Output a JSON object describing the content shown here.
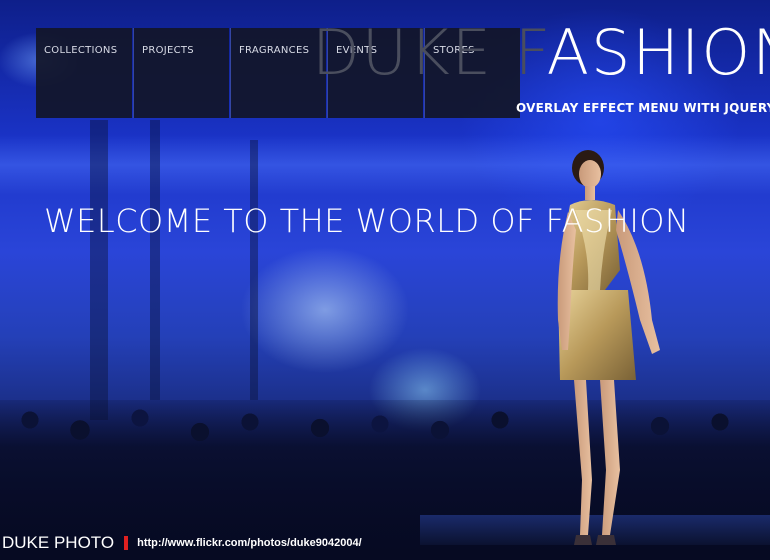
{
  "header": {
    "title_dim": "DUKE F",
    "title_bright": "ASHION",
    "subtitle": "OVERLAY EFFECT MENU WITH JQUERY"
  },
  "menu": {
    "items": [
      {
        "label": "COLLECTIONS"
      },
      {
        "label": "PROJECTS"
      },
      {
        "label": "FRAGRANCES"
      },
      {
        "label": "EVENTS"
      },
      {
        "label": "STORES"
      }
    ]
  },
  "hero": {
    "welcome_text": "WELCOME TO THE WORLD OF FASHION"
  },
  "credit": {
    "brand": "DUKE PHOTO",
    "url": "http://www.flickr.com/photos/duke9042004/"
  },
  "colors": {
    "menu_bg": "#12162a",
    "accent_bar": "#e02020",
    "text": "#ffffff"
  }
}
